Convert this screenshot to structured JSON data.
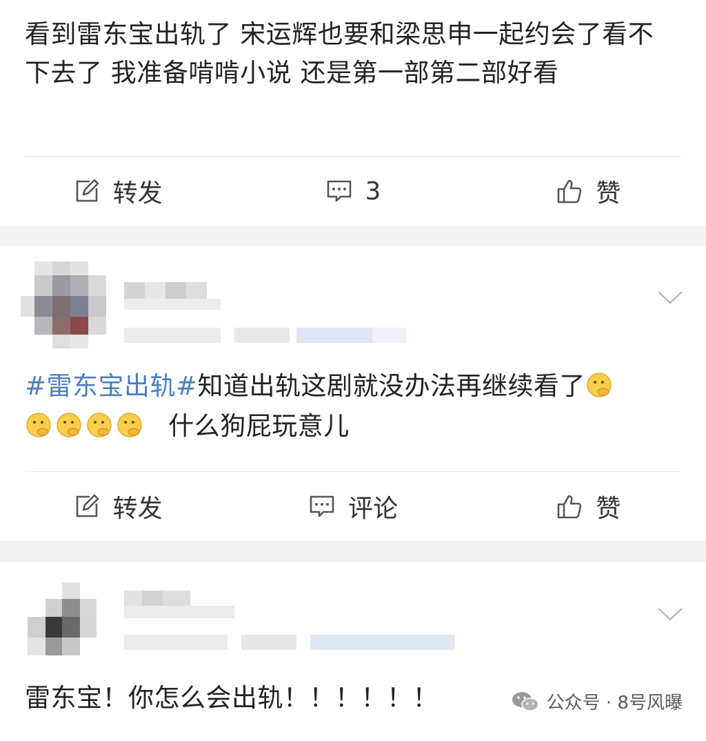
{
  "post1": {
    "text": "看到雷东宝出轨了 宋运辉也要和梁思申一起约会了看不下去了 我准备啃啃小说 还是第一部第二部好看",
    "repost_label": "转发",
    "comment_count": "3",
    "like_label": "赞"
  },
  "post2": {
    "hashtag": "#雷东宝出轨#",
    "text": "知道出轨这剧就没办法再继续看了",
    "text_after_emoji": "什么狗屁玩意儿",
    "repost_label": "转发",
    "comment_label": "评论",
    "like_label": "赞"
  },
  "post3": {
    "text": "雷东宝！你怎么会出轨！！！！！！"
  },
  "watermark": {
    "text": "公众号 · 8号风曝"
  },
  "icons": {
    "repost": "edit-square-icon",
    "comment": "comment-bubble-icon",
    "like": "thumbs-up-icon",
    "more": "chevron-down-icon",
    "emoji": "thinking-face-icon"
  }
}
